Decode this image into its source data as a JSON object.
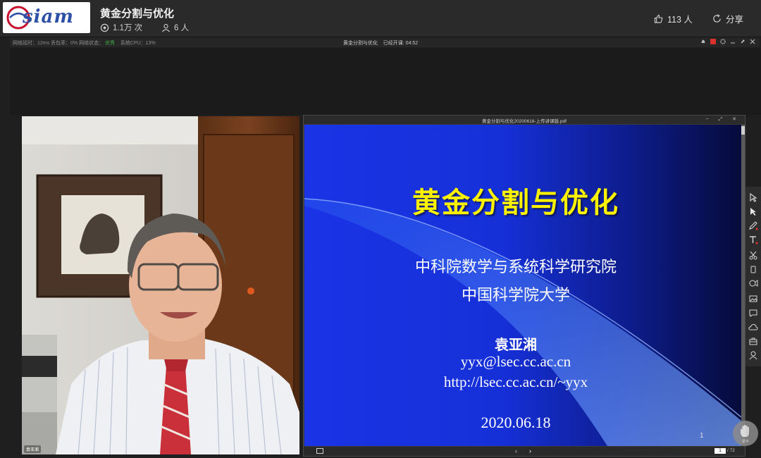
{
  "header": {
    "logo_text": "siam",
    "title": "黄金分割与优化",
    "views": "1.1万 次",
    "viewers": "6 人",
    "likes": "113 人",
    "share_label": "分享"
  },
  "status_bar": {
    "network_text": "网络延时：12ms 丢包率：0% 网络状态：",
    "network_state": "优秀",
    "cpu_text": "系统CPU：13%",
    "center_title": "黄金分割与优化",
    "center_time": "已经开课: 04:52"
  },
  "camera": {
    "name_label": "袁亚湘"
  },
  "slide_viewer": {
    "file_name": "黄金分割与优化20200618-上传讲课版.pdf",
    "window_buttons": "− ⤢ ✕",
    "current_page": "1",
    "total_pages": "/ 72",
    "prev_symbol": "‹",
    "next_symbol": "›"
  },
  "slide": {
    "title": "黄金分割与优化",
    "affiliation_1": "中科院数学与系统科学研究院",
    "affiliation_2": "中国科学院大学",
    "author": "袁亚湘",
    "email": "yyx@lsec.cc.ac.cn",
    "url": "http://lsec.cc.ac.cn/~yyx",
    "date": "2020.06.18",
    "page_number": "1"
  },
  "tools": [
    "select-icon",
    "pointer-icon",
    "pen-icon",
    "text-icon",
    "scissors-icon",
    "eraser-icon",
    "record-icon",
    "image-icon",
    "chat-icon",
    "cloud-icon",
    "toolbox-icon",
    "user-icon"
  ],
  "hand_button": {
    "label": "举手"
  }
}
